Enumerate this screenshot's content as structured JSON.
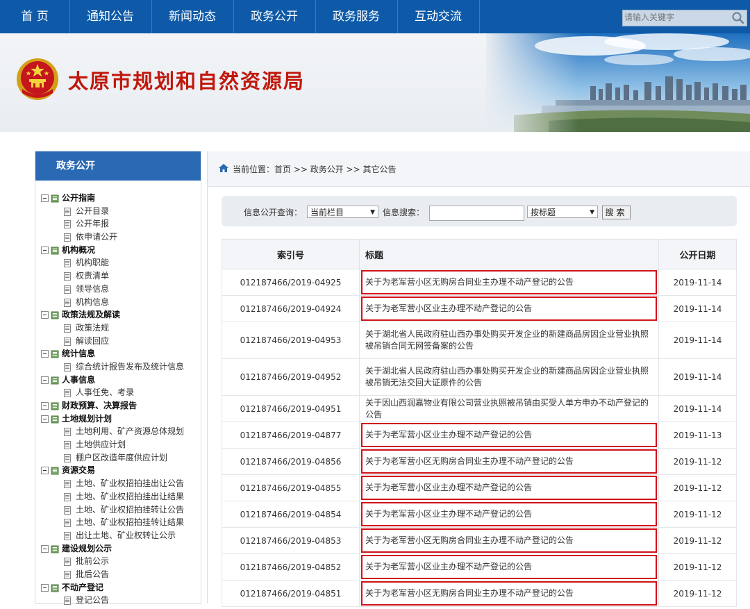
{
  "nav": {
    "items": [
      "首 页",
      "通知公告",
      "新闻动态",
      "政务公开",
      "政务服务",
      "互动交流"
    ],
    "search_placeholder": "请输入关键字"
  },
  "banner": {
    "title": "太原市规划和自然资源局"
  },
  "sidebar": {
    "heading": "政务公开",
    "tree": [
      {
        "label": "公开指南",
        "level": 0
      },
      {
        "label": "公开目录",
        "level": 1
      },
      {
        "label": "公开年报",
        "level": 1
      },
      {
        "label": "依申请公开",
        "level": 1
      },
      {
        "label": "机构概况",
        "level": 0
      },
      {
        "label": "机构职能",
        "level": 1
      },
      {
        "label": "权责清单",
        "level": 1
      },
      {
        "label": "领导信息",
        "level": 1
      },
      {
        "label": "机构信息",
        "level": 1
      },
      {
        "label": "政策法规及解读",
        "level": 0
      },
      {
        "label": "政策法规",
        "level": 1
      },
      {
        "label": "解读回应",
        "level": 1
      },
      {
        "label": "统计信息",
        "level": 0
      },
      {
        "label": "综合统计报告发布及统计信息",
        "level": 1
      },
      {
        "label": "人事信息",
        "level": 0
      },
      {
        "label": "人事任免、考录",
        "level": 1
      },
      {
        "label": "财政预算、决算报告",
        "level": 0
      },
      {
        "label": "土地规划计划",
        "level": 0
      },
      {
        "label": "土地利用、矿产资源总体规划",
        "level": 1
      },
      {
        "label": "土地供应计划",
        "level": 1
      },
      {
        "label": "棚户区改造年度供应计划",
        "level": 1
      },
      {
        "label": "资源交易",
        "level": 0
      },
      {
        "label": "土地、矿业权招拍挂出让公告",
        "level": 1
      },
      {
        "label": "土地、矿业权招拍挂出让结果",
        "level": 1
      },
      {
        "label": "土地、矿业权招拍挂转让公告",
        "level": 1
      },
      {
        "label": "土地、矿业权招拍挂转让结果",
        "level": 1
      },
      {
        "label": "出让土地、矿业权转让公示",
        "level": 1
      },
      {
        "label": "建设规划公示",
        "level": 0
      },
      {
        "label": "批前公示",
        "level": 1
      },
      {
        "label": "批后公告",
        "level": 1
      },
      {
        "label": "不动产登记",
        "level": 0
      },
      {
        "label": "登记公告",
        "level": 1
      }
    ]
  },
  "breadcrumb": "当前位置：首页 >> 政务公开 >> 其它公告",
  "query": {
    "label1": "信息公开查询：",
    "select1": "当前栏目",
    "label2": "信息搜索：",
    "input_value": "",
    "select2": "按标题",
    "button": "搜索"
  },
  "table": {
    "headers": [
      "索引号",
      "标题",
      "公开日期"
    ],
    "rows": [
      {
        "index": "012187466/2019-04925",
        "title": "关于为老军营小区无购房合同业主办理不动产登记的公告",
        "date": "2019-11-14",
        "highlighted": true
      },
      {
        "index": "012187466/2019-04924",
        "title": "关于为老军营小区业主办理不动产登记的公告",
        "date": "2019-11-14",
        "highlighted": true
      },
      {
        "index": "012187466/2019-04953",
        "title": "关于湖北省人民政府驻山西办事处购买开发企业的新建商品房因企业营业执照被吊销合同无网签备案的公告",
        "date": "2019-11-14",
        "highlighted": false
      },
      {
        "index": "012187466/2019-04952",
        "title": "关于湖北省人民政府驻山西办事处购买开发企业的新建商品房因企业营业执照被吊销无法交回大证原件的公告",
        "date": "2019-11-14",
        "highlighted": false
      },
      {
        "index": "012187466/2019-04951",
        "title": "关于因山西润嘉物业有限公司营业执照被吊销由买受人单方申办不动产登记的公告",
        "date": "2019-11-14",
        "highlighted": false
      },
      {
        "index": "012187466/2019-04877",
        "title": "关于为老军营小区业主办理不动产登记的公告",
        "date": "2019-11-13",
        "highlighted": true
      },
      {
        "index": "012187466/2019-04856",
        "title": "关于为老军营小区无购房合同业主办理不动产登记的公告",
        "date": "2019-11-12",
        "highlighted": true
      },
      {
        "index": "012187466/2019-04855",
        "title": "关于为老军营小区业主办理不动产登记的公告",
        "date": "2019-11-12",
        "highlighted": true
      },
      {
        "index": "012187466/2019-04854",
        "title": "关于为老军营小区业主办理不动产登记的公告",
        "date": "2019-11-12",
        "highlighted": true
      },
      {
        "index": "012187466/2019-04853",
        "title": "关于为老军营小区无购房合同业主办理不动产登记的公告",
        "date": "2019-11-12",
        "highlighted": true
      },
      {
        "index": "012187466/2019-04852",
        "title": "关于为老军营小区业主办理不动产登记的公告",
        "date": "2019-11-12",
        "highlighted": true
      },
      {
        "index": "012187466/2019-04851",
        "title": "关于为老军营小区无购房合同业主办理不动产登记的公告",
        "date": "2019-11-12",
        "highlighted": true
      }
    ]
  },
  "colors": {
    "nav_bg": "#0e5aa8",
    "title_red": "#c0180c",
    "highlight_border": "#d0121a",
    "sidebar_head": "#2a69b3"
  }
}
